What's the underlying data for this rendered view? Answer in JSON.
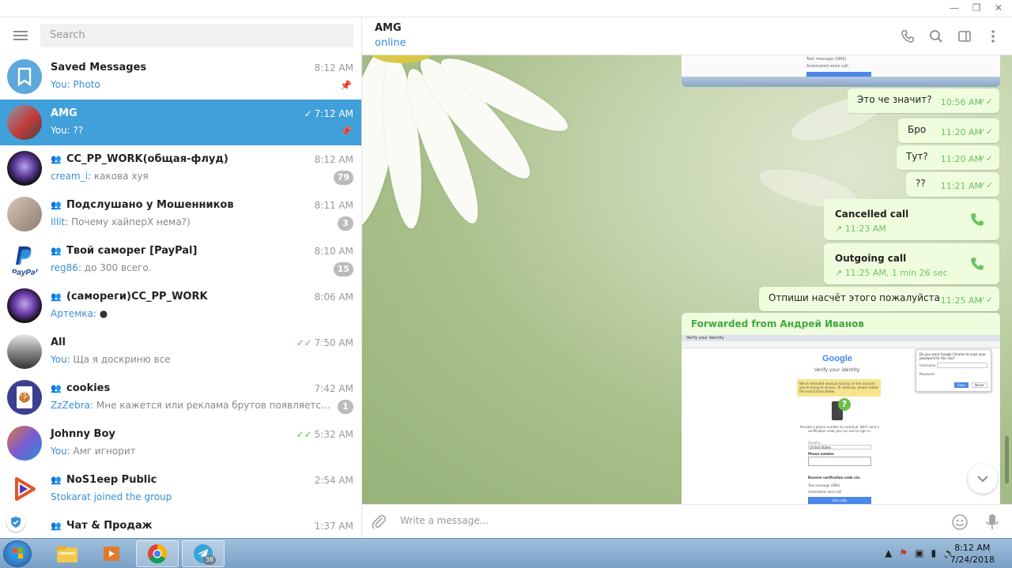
{
  "window": {
    "minimize": "—",
    "restore": "❐",
    "close": "✕"
  },
  "sidebar": {
    "search_placeholder": "Search",
    "chats": [
      {
        "name": "Saved Messages",
        "time": "8:12 AM",
        "who": "You: ",
        "preview": "Photo",
        "pinned": true,
        "group": false,
        "read": false,
        "badge": ""
      },
      {
        "name": "AMG",
        "time": "7:12 AM",
        "who": "",
        "preview": "You: ??",
        "pinned": true,
        "group": false,
        "read": true,
        "badge": ""
      },
      {
        "name": "CC_PP_WORK(общая-флуд)",
        "time": "8:12 AM",
        "who": "cream_i: ",
        "preview": "какова хуя",
        "pinned": false,
        "group": true,
        "read": false,
        "badge": "79"
      },
      {
        "name": "Подслушано у Мошенников",
        "time": "8:11 AM",
        "who": "Illit: ",
        "preview": "Почему хайперХ нема?)",
        "pinned": false,
        "group": true,
        "read": false,
        "badge": "3"
      },
      {
        "name": "Твой саморег [PayPal]",
        "time": "8:10 AM",
        "who": "reg86: ",
        "preview": "до 300 всего.",
        "pinned": false,
        "group": true,
        "read": false,
        "badge": "15"
      },
      {
        "name": "(самореги)CC_PP_WORK",
        "time": "8:06 AM",
        "who": "Артемка: ",
        "preview": "●",
        "pinned": false,
        "group": true,
        "read": false,
        "badge": ""
      },
      {
        "name": "All",
        "time": "7:50 AM",
        "who": "You: ",
        "preview": "Ща я доскриню все",
        "pinned": false,
        "group": false,
        "read": true,
        "badge": ""
      },
      {
        "name": "cookies",
        "time": "7:42 AM",
        "who": "ZzZebra: ",
        "preview": "Мне кажется или реклама брутов появляется в чате...",
        "pinned": false,
        "group": true,
        "read": false,
        "badge": "1"
      },
      {
        "name": "Johnny Boy",
        "time": "5:32 AM",
        "who": "You: ",
        "preview": "Амг игнорит",
        "pinned": false,
        "group": false,
        "read": true,
        "badge": ""
      },
      {
        "name": "NoS1eep Public",
        "time": "2:54 AM",
        "who": "Stokarat joined the group",
        "preview": "",
        "pinned": false,
        "group": true,
        "read": false,
        "badge": ""
      },
      {
        "name": "Чат & Продаж",
        "time": "1:37 AM",
        "who": "",
        "preview": "",
        "pinned": false,
        "group": true,
        "read": false,
        "badge": ""
      }
    ]
  },
  "header": {
    "title": "AMG",
    "status": "online"
  },
  "messages": {
    "m1": {
      "text": "Это че значит?",
      "time": "10:56 AM"
    },
    "m2": {
      "text": "Бро",
      "time": "11:20 AM"
    },
    "m3": {
      "text": "Тут?",
      "time": "11:20 AM"
    },
    "m4": {
      "text": "??",
      "time": "11:21 AM"
    },
    "call1": {
      "title": "Cancelled call",
      "meta": "↗  11:23 AM"
    },
    "call2": {
      "title": "Outgoing call",
      "meta": "↗  11:25 AM, 1 min 26 sec"
    },
    "m5": {
      "text": "Отпиши насчёт этого пожалуйста",
      "time": "11:25 AM"
    },
    "forwarded": {
      "label": "Forwarded from Андрей Иванов",
      "google_logo": "Google",
      "verify": "Verify your identity",
      "notice": "We've detected unusual activity on the account you're trying to access. To continue, please follow the instructions below.",
      "phone_prompt": "Provide a phone number to continue. We'll send a verification code you can use to sign in.",
      "country_label": "Country",
      "country_value": "United States",
      "phone_label": "Phone number",
      "receive_label": "Receive verification code via:",
      "opt_sms": "Text message (SMS)",
      "opt_voice": "Automated voice call",
      "submit": "Get code",
      "popup_title": "Do you want Google Chrome to save your password for this site?",
      "popup_username_label": "Username",
      "popup_password_label": "Password",
      "popup_save": "Save",
      "popup_never": "Never",
      "tab_label": "Verify your identity"
    },
    "top_shot": {
      "opt_sms": "Text message (SMS)",
      "opt_voice": "Automated voice call"
    }
  },
  "composer": {
    "placeholder": "Write a message..."
  },
  "taskbar": {
    "telegram_badge": "38",
    "time": "8:12 AM",
    "date": "7/24/2018"
  }
}
